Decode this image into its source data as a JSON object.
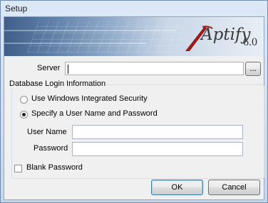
{
  "window": {
    "title": "Setup"
  },
  "banner": {
    "brand": "Aptify",
    "version": "6.0",
    "logo_icon": "aptify-logo-icon"
  },
  "server": {
    "label": "Server",
    "value": "",
    "browse_label": "..."
  },
  "login_group": {
    "title": "Database Login Information",
    "options": [
      {
        "label": "Use Windows Integrated Security",
        "selected": false
      },
      {
        "label": "Specify a User Name and Password",
        "selected": true
      }
    ],
    "username": {
      "label": "User Name",
      "value": ""
    },
    "password": {
      "label": "Password",
      "value": ""
    }
  },
  "blank_password": {
    "label": "Blank Password",
    "checked": false
  },
  "buttons": {
    "ok": "OK",
    "cancel": "Cancel"
  },
  "colors": {
    "accent": "#3c7fb1",
    "banner_dark": "#3f5f8a"
  }
}
